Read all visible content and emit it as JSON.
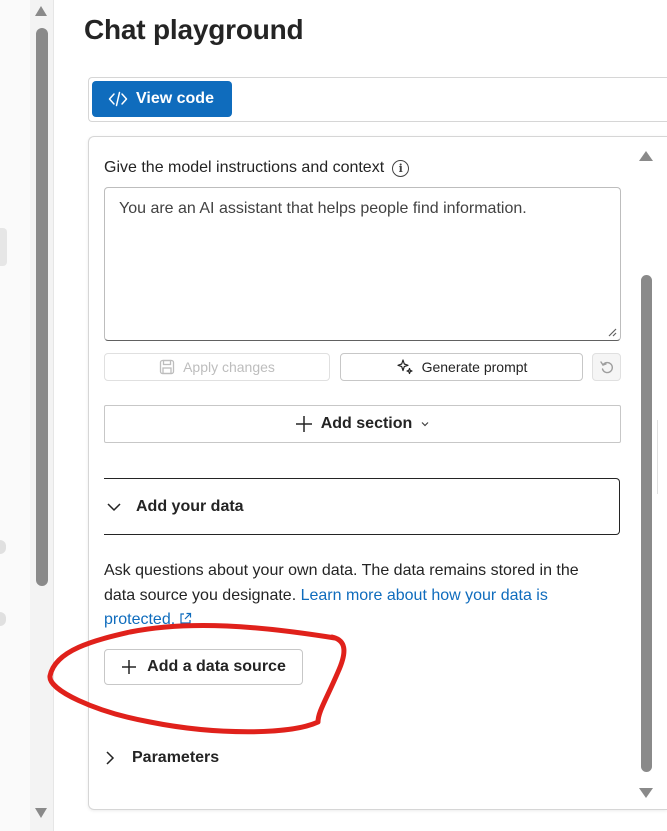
{
  "page": {
    "title": "Chat playground"
  },
  "toolbar": {
    "view_code_label": "View code"
  },
  "setup": {
    "instructions_label": "Give the model instructions and context",
    "system_message_value": "You are an AI assistant that helps people find information.",
    "apply_changes_label": "Apply changes",
    "generate_prompt_label": "Generate prompt",
    "add_section_label": "Add section"
  },
  "add_your_data": {
    "header_label": "Add your data",
    "description": "Ask questions about your own data. The data remains stored in the data source you designate. ",
    "learn_more_link": "Learn more about how your data is protected.",
    "add_source_label": "Add a data source"
  },
  "parameters": {
    "header_label": "Parameters"
  },
  "colors": {
    "primary": "#0f6cbd",
    "annotation": "#e0211b",
    "text": "#242424"
  }
}
